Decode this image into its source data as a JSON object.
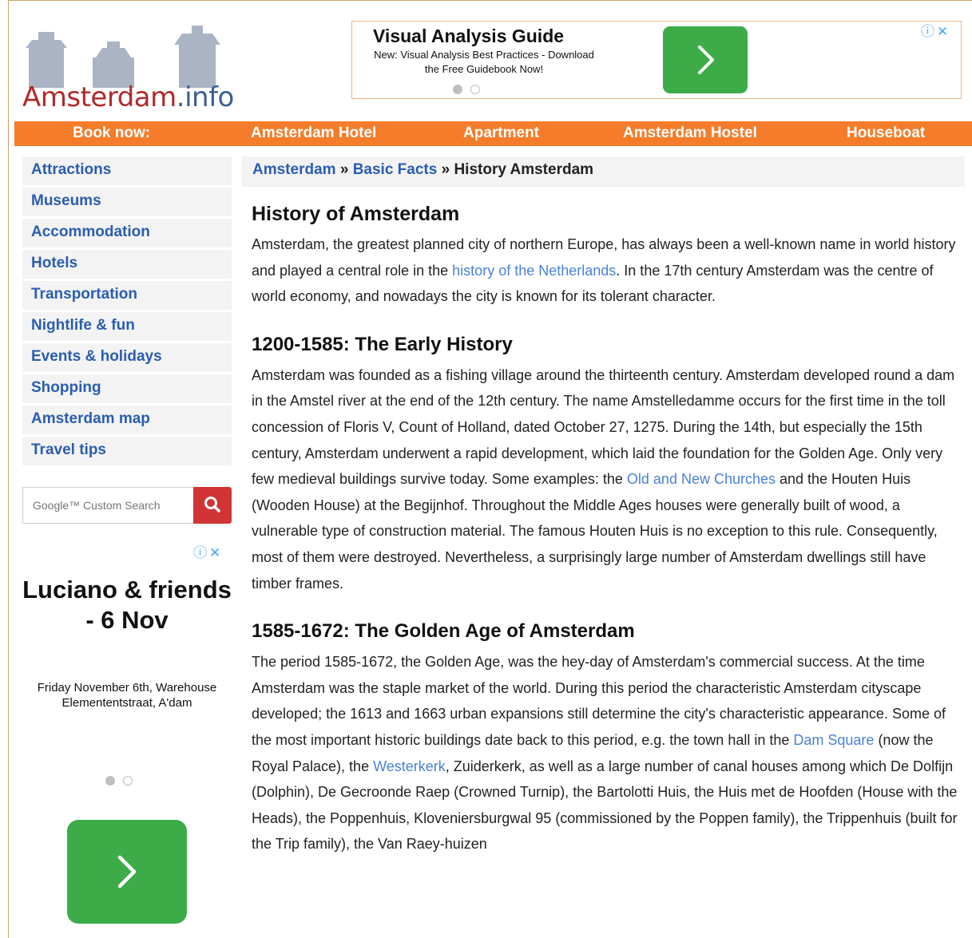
{
  "logo": {
    "main": "Amsterdam",
    "suffix": ".info"
  },
  "top_ad": {
    "title": "Visual Analysis Guide",
    "description": "New: Visual Analysis Best Practices - Download the Free Guidebook Now!",
    "button_icon": "chevron-right-icon",
    "button_color": "#3cab48"
  },
  "nav": {
    "book_now": "Book now:",
    "items": [
      "Amsterdam Hotel",
      "Apartment",
      "Amsterdam Hostel",
      "Houseboat"
    ],
    "color": "#f47c2a"
  },
  "sidebar": {
    "items": [
      "Attractions",
      "Museums",
      "Accommodation",
      "Hotels",
      "Transportation",
      "Nightlife & fun",
      "Events & holidays",
      "Shopping",
      "Amsterdam map",
      "Travel tips"
    ]
  },
  "search": {
    "placeholder": "Google™ Custom Search",
    "button_icon": "search-icon",
    "button_color": "#d03434"
  },
  "side_ad": {
    "headline": "Luciano & friends - 6 Nov",
    "details": "Friday November 6th, Warehouse Elemententstraat, A'dam",
    "button_icon": "chevron-right-icon"
  },
  "breadcrumb": {
    "home": "Amsterdam",
    "section": "Basic Facts",
    "current": "History Amsterdam",
    "sep": "»"
  },
  "content": {
    "title": "History of Amsterdam",
    "intro": {
      "before": "Amsterdam, the greatest planned city of northern Europe, has always been a well-known name in world history and played a central role in the ",
      "link": "history of the Netherlands",
      "after": ". In the 17th century Amsterdam was the centre of world economy, and nowadays the city is known for its tolerant character."
    },
    "section1": {
      "heading": "1200-1585: The Early History",
      "before": "Amsterdam was founded as a fishing village around the thirteenth century. Amsterdam developed round a dam in the Amstel river at the end of the 12th century. The name Amstelledamme occurs for the first time in the toll concession of Floris V, Count of Holland, dated October 27, 1275. During the 14th, but especially the 15th century, Amsterdam underwent a rapid development, which laid the foundation for the Golden Age. Only very few medieval buildings survive today. Some examples: the ",
      "link": "Old and New Churches",
      "after": " and the Houten Huis (Wooden House) at the Begijnhof. Throughout the Middle Ages houses were generally built of wood, a vulnerable type of construction material. The famous Houten Huis is no exception to this rule. Consequently, most of them were destroyed. Nevertheless, a surprisingly large number of Amsterdam dwellings still have timber frames."
    },
    "section2": {
      "heading": "1585-1672: The Golden Age of Amsterdam",
      "before": "The period 1585-1672, the Golden Age, was the hey-day of Amsterdam's commercial success. At the time Amsterdam was the staple market of the world. During this period the characteristic Amsterdam cityscape developed; the 1613 and 1663 urban expansions still determine the city's characteristic appearance. Some of the most important historic buildings date back to this period, e.g. the town hall in the ",
      "link1": "Dam Square",
      "middle": " (now the Royal Palace), the ",
      "link2": "Westerkerk",
      "after": ", Zuiderkerk, as well as a large number of canal houses among which De Dolfijn (Dolphin), De Gecroonde Raep (Crowned Turnip), the Bartolotti Huis, the Huis met de Hoofden (House with the Heads), the Poppenhuis, Kloveniersburgwal 95 (commissioned by the Poppen family), the Trippenhuis (built for the Trip family), the Van Raey-huizen"
    }
  }
}
